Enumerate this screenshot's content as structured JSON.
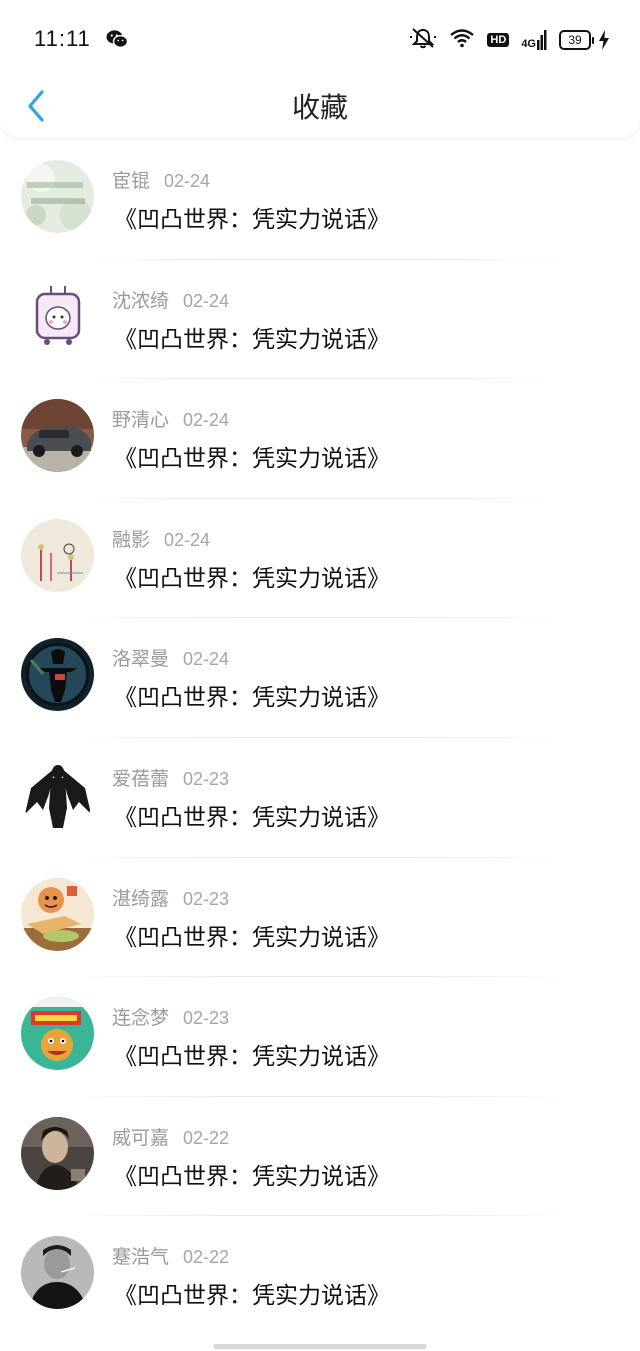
{
  "status_bar": {
    "time": "11:11",
    "network": "4G",
    "hd": "HD",
    "battery": "39"
  },
  "header": {
    "title": "收藏"
  },
  "items": [
    {
      "name": "宦锟",
      "date": "02-24",
      "title": "《凹凸世界：凭实力说话》",
      "avatar": "avatar-1"
    },
    {
      "name": "沈浓绮",
      "date": "02-24",
      "title": "《凹凸世界：凭实力说话》",
      "avatar": "avatar-2"
    },
    {
      "name": "野清心",
      "date": "02-24",
      "title": "《凹凸世界：凭实力说话》",
      "avatar": "avatar-3"
    },
    {
      "name": "融影",
      "date": "02-24",
      "title": "《凹凸世界：凭实力说话》",
      "avatar": "avatar-4"
    },
    {
      "name": "洛翠曼",
      "date": "02-24",
      "title": "《凹凸世界：凭实力说话》",
      "avatar": "avatar-5"
    },
    {
      "name": "爱蓓蕾",
      "date": "02-23",
      "title": "《凹凸世界：凭实力说话》",
      "avatar": "avatar-6"
    },
    {
      "name": "湛绮露",
      "date": "02-23",
      "title": "《凹凸世界：凭实力说话》",
      "avatar": "avatar-7"
    },
    {
      "name": "连念梦",
      "date": "02-23",
      "title": "《凹凸世界：凭实力说话》",
      "avatar": "avatar-8"
    },
    {
      "name": "威可嘉",
      "date": "02-22",
      "title": "《凹凸世界：凭实力说话》",
      "avatar": "avatar-9"
    },
    {
      "name": "蹇浩气",
      "date": "02-22",
      "title": "《凹凸世界：凭实力说话》",
      "avatar": "avatar-10"
    }
  ],
  "colors": {
    "accent": "#2aa3e8",
    "name_text": "#9a9a9a",
    "title_text": "#111111"
  }
}
